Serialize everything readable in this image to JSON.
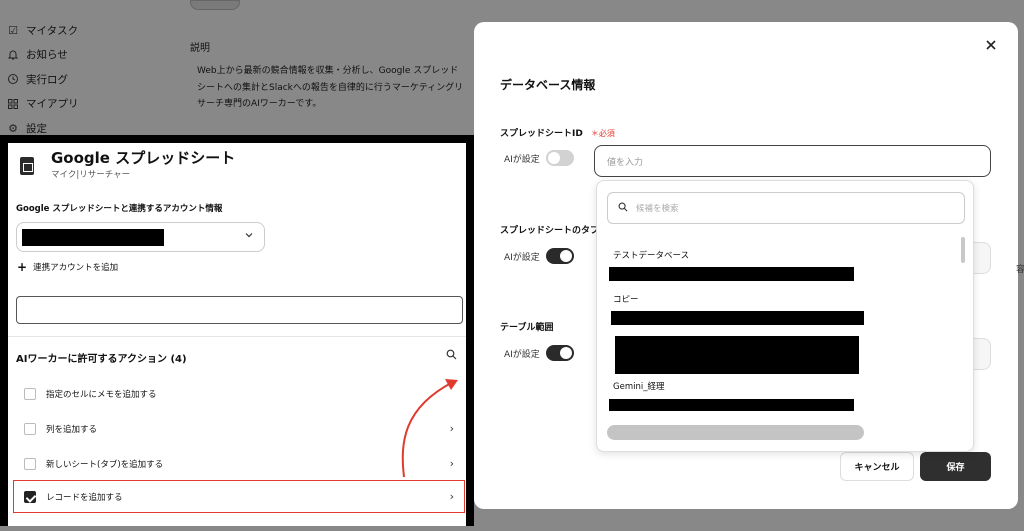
{
  "background": {
    "nav_items": [
      {
        "label": "マイタスク",
        "icon": "checkbox-icon"
      },
      {
        "label": "お知らせ",
        "icon": "bell-icon"
      },
      {
        "label": "実行ログ",
        "icon": "clock-icon"
      },
      {
        "label": "マイアプリ",
        "icon": "grid-icon"
      },
      {
        "label": "設定",
        "icon": "gear-icon"
      }
    ],
    "description_title": "説明",
    "description_text": "Web上から最新の競合情報を収集・分析し、Google スプレッドシートへの集計とSlackへの報告を自律的に行うマーケティングリサーチ専門のAIワーカーです。"
  },
  "left_panel": {
    "app_title": "Google スプレッドシート",
    "app_subtitle": "マイク|リサーチャー",
    "account_label": "Google スプレッドシートと連携するアカウント情報",
    "add_account_label": "連携アカウントを追加",
    "actions_title": "AIワーカーに許可するアクション (4)",
    "actions": [
      {
        "label": "指定のセルにメモを追加する",
        "checked": false
      },
      {
        "label": "列を追加する",
        "checked": false
      },
      {
        "label": "新しいシート(タブ)を追加する",
        "checked": false
      },
      {
        "label": "レコードを追加する",
        "checked": true
      }
    ]
  },
  "modal": {
    "title": "データベース情報",
    "spreadsheet_id_label": "スプレッドシートID",
    "required_label": "＊必須",
    "ai_setting_label": "AIが設定",
    "input_placeholder": "値を入力",
    "sheet_tab_label": "スプレッドシートのタブ",
    "table_range_label": "テーブル範囲",
    "toggles": [
      false,
      true,
      true
    ],
    "cancel_label": "キャンセル",
    "save_label": "保存"
  },
  "dropdown": {
    "search_placeholder": "候補を検索",
    "items": [
      "テストデータベース",
      "コピー",
      "Gemini_経理"
    ]
  },
  "edge_text": "容",
  "colors": {
    "accent_red": "#e03a2f",
    "dark": "#2f2f2f"
  }
}
